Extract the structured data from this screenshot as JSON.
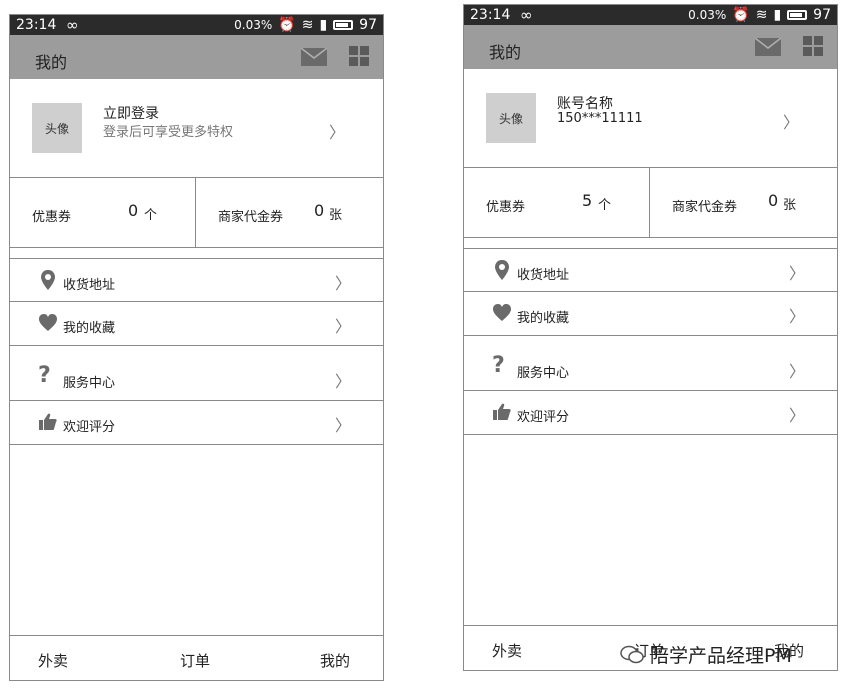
{
  "status_bar": {
    "time": "23:14",
    "percent_text": "0.03",
    "battery": "97"
  },
  "header": {
    "title": "我的"
  },
  "icons": {
    "mail": "mail-icon",
    "grid": "grid-icon",
    "location": "location-pin-icon",
    "favorite": "heart-icon",
    "service": "question-mark-icon",
    "rate": "thumbs-up-icon",
    "chevron": "chevron-right-icon"
  },
  "colors": {
    "header_bg": "#9c9c9c",
    "status_bg": "#2b2b2b",
    "avatar_bg": "#cfcfcf"
  },
  "screens": [
    {
      "profile": {
        "avatar_label": "头像",
        "name": "立即登录",
        "subtitle": "登录后可享受更多特权"
      },
      "coupons": [
        {
          "label": "优惠券",
          "count": "0",
          "unit": "个"
        },
        {
          "label": "商家代金券",
          "count": "0",
          "unit": "张"
        }
      ],
      "menu": [
        "收货地址",
        "我的收藏",
        "服务中心",
        "欢迎评分"
      ],
      "tabs": [
        "外卖",
        "订单",
        "我的"
      ]
    },
    {
      "profile": {
        "avatar_label": "头像",
        "name": "账号名称",
        "subtitle": "150***11111"
      },
      "coupons": [
        {
          "label": "优惠券",
          "count": "5",
          "unit": "个"
        },
        {
          "label": "商家代金券",
          "count": "0",
          "unit": "张"
        }
      ],
      "menu": [
        "收货地址",
        "我的收藏",
        "服务中心",
        "欢迎评分"
      ],
      "tabs": [
        "外卖",
        "订单",
        "我的"
      ]
    }
  ],
  "watermark": {
    "text": "陪学产品经理PM"
  }
}
